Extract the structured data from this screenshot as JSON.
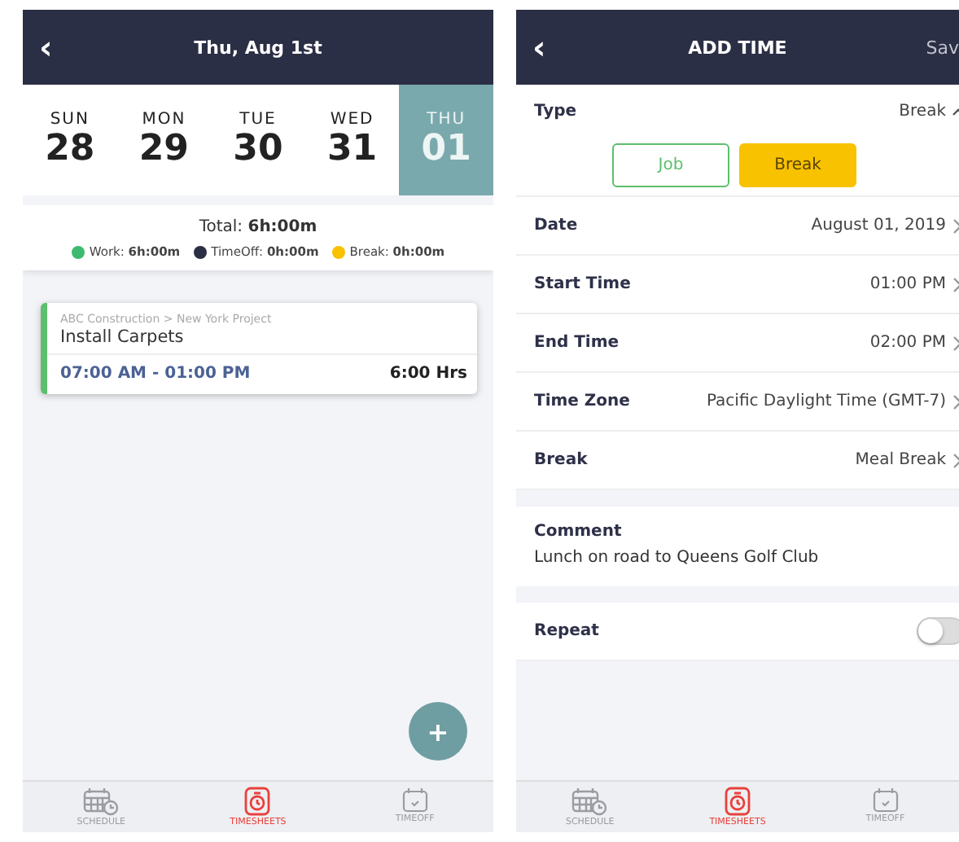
{
  "left_screen": {
    "header": {
      "back": "‹",
      "title": "Thu, Aug 1st"
    },
    "days": [
      {
        "weekday": "SUN",
        "date": "28",
        "selected": false
      },
      {
        "weekday": "MON",
        "date": "29",
        "selected": false
      },
      {
        "weekday": "TUE",
        "date": "30",
        "selected": false
      },
      {
        "weekday": "WED",
        "date": "31",
        "selected": false
      },
      {
        "weekday": "THU",
        "date": "01",
        "selected": true
      }
    ],
    "total": "Total: **6h:00m**",
    "legend": [
      {
        "label": "Work: **6h:00m**",
        "color": "#3dba6f"
      },
      {
        "label": "TimeOff: **0h:00m**",
        "color": "#2b2f45"
      },
      {
        "label": "Break: **0h:00m**",
        "color": "#f8c200"
      }
    ],
    "entries": [
      {
        "path": "ABC Construction > New York Project",
        "task": "Install Carpets",
        "time_range": "07:00 AM - 01:00 PM",
        "hours": "6:00 Hrs",
        "color": "#5cbf6c"
      }
    ],
    "fab": "+",
    "tabs": [
      {
        "label": "SCHEDULE",
        "kind": "schedule",
        "selected": false
      },
      {
        "label": "TIMESHEETS",
        "kind": "timesheets",
        "selected": true
      },
      {
        "label": "TIMEOFF",
        "kind": "timeoff",
        "selected": false
      }
    ]
  },
  "right_screen": {
    "header": {
      "back": "‹",
      "title": "ADD TIME",
      "action": "Sav"
    },
    "type": {
      "label": "Type",
      "value": "Break",
      "expanded": true,
      "options": [
        {
          "label": "Job",
          "selected": false
        },
        {
          "label": "Break",
          "selected": true
        }
      ]
    },
    "fields": [
      {
        "label": "Date",
        "value": "August 01, 2019"
      },
      {
        "label": "Start Time",
        "value": "01:00 PM"
      },
      {
        "label": "End Time",
        "value": "02:00 PM"
      },
      {
        "label": "Time Zone",
        "value": "Pacific Daylight Time (GMT-7)"
      },
      {
        "label": "Break",
        "value": "Meal Break"
      }
    ],
    "comment": {
      "label": "Comment",
      "value": "Lunch on road to Queens Golf Club"
    },
    "repeat": {
      "label": "Repeat",
      "on": false
    },
    "tabs": [
      {
        "label": "SCHEDULE",
        "kind": "schedule",
        "selected": false
      },
      {
        "label": "TIMESHEETS",
        "kind": "timesheets",
        "selected": true
      },
      {
        "label": "TIMEOFF",
        "kind": "timeoff",
        "selected": false
      }
    ]
  }
}
